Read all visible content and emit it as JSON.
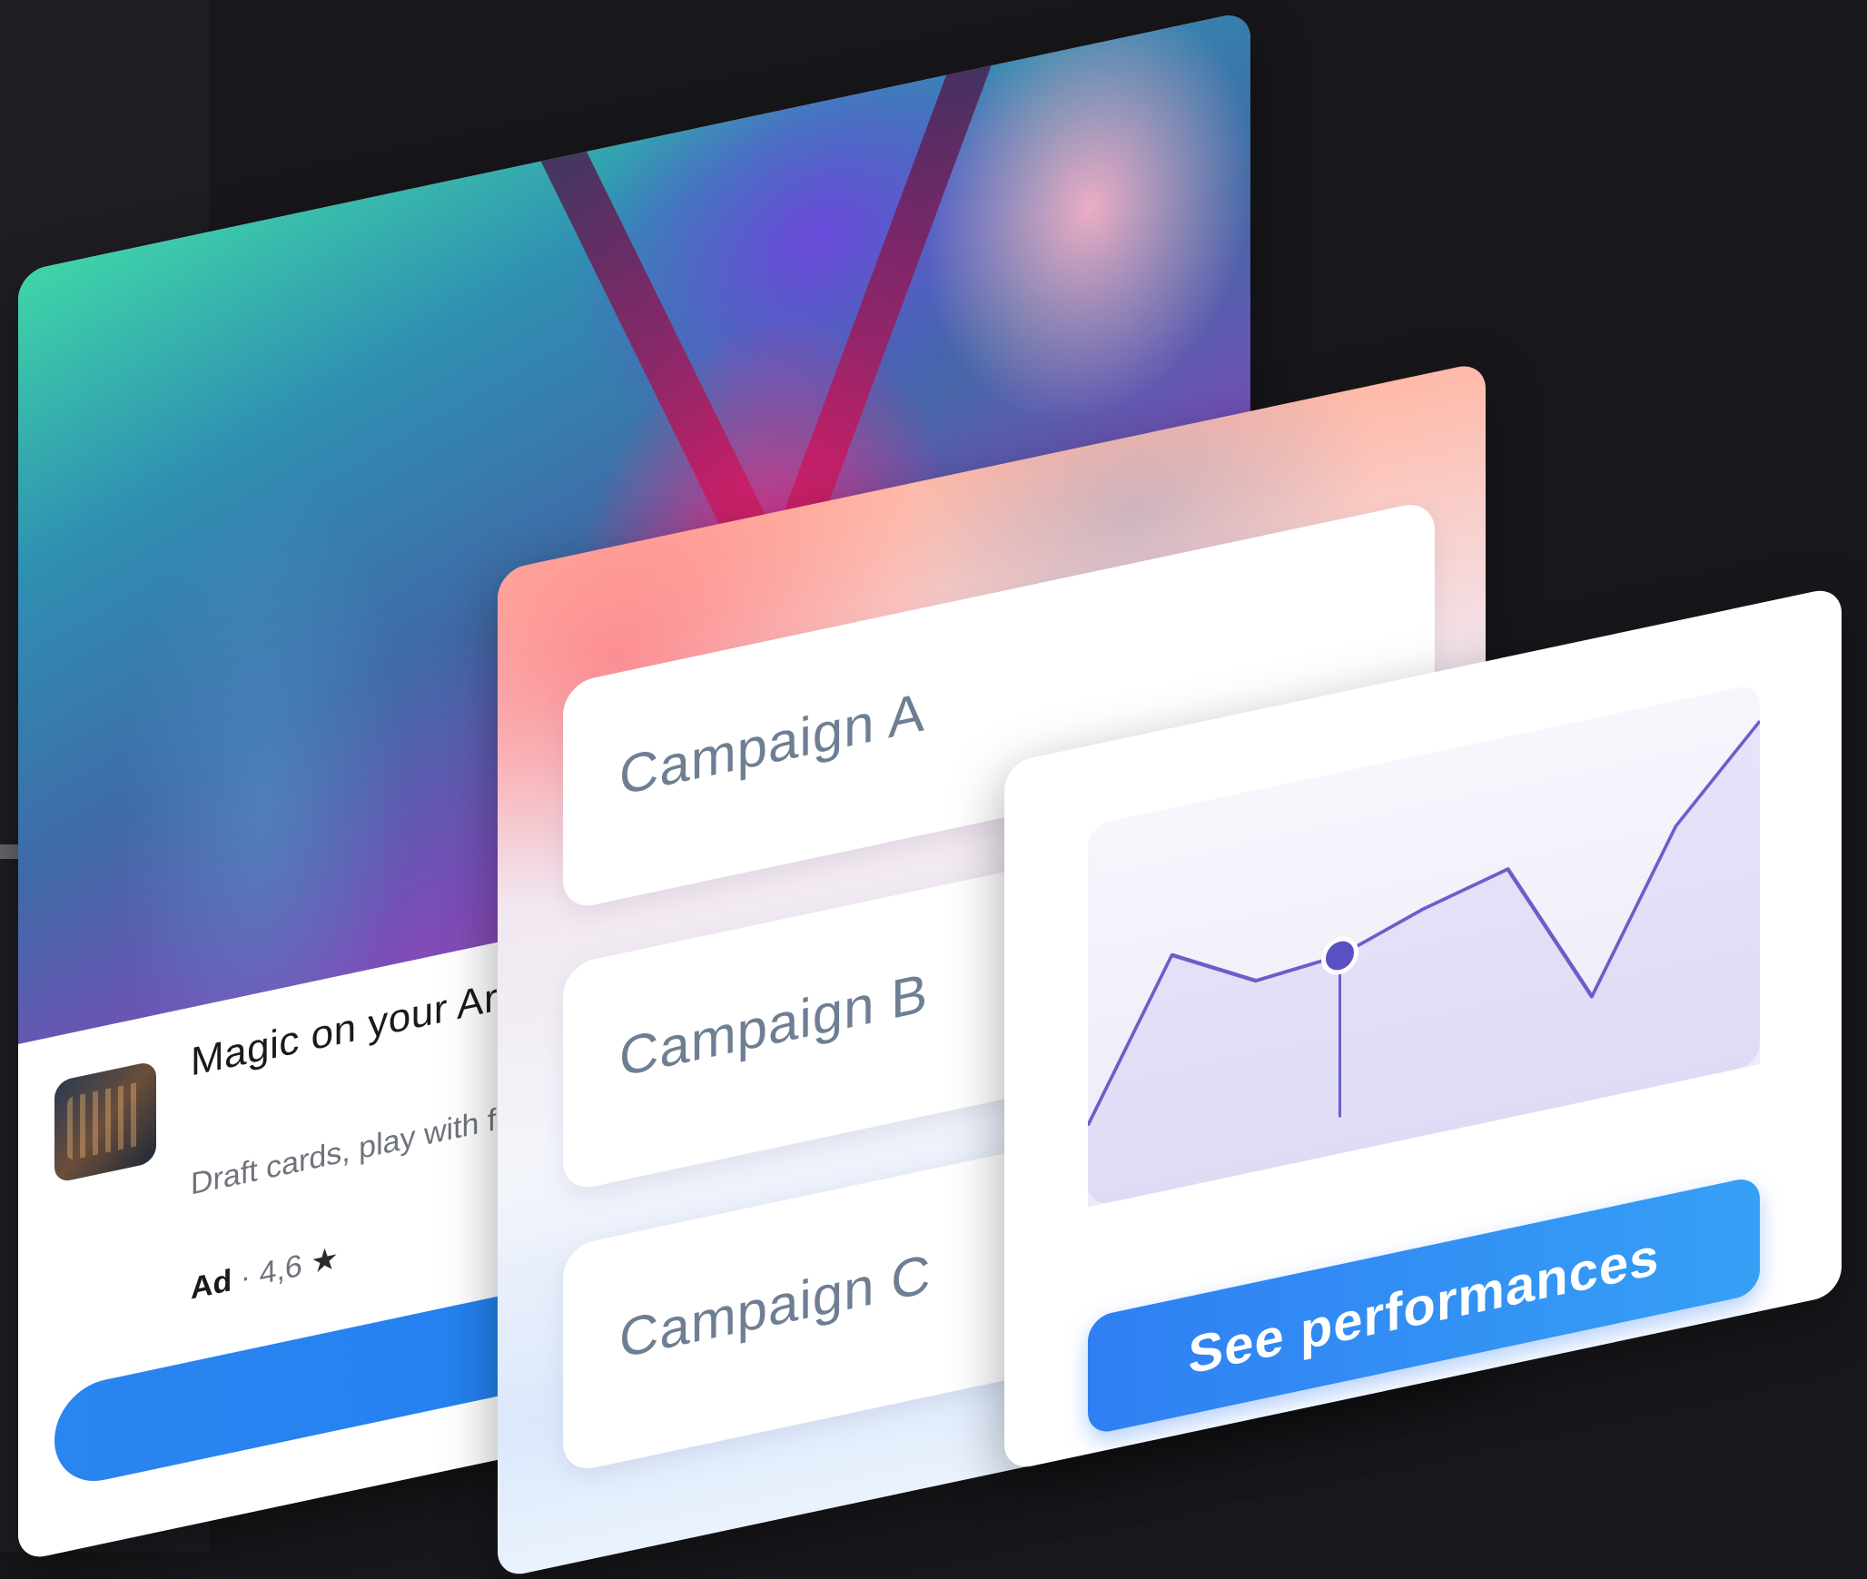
{
  "ad": {
    "title": "Magic on your Arena",
    "description": "Draft cards, play with friends. All on your",
    "label": "Ad",
    "rating": "4,6"
  },
  "campaigns": {
    "items": [
      {
        "label": "Campaign A"
      },
      {
        "label": "Campaign B"
      },
      {
        "label": "Campaign C"
      }
    ]
  },
  "performance": {
    "button_label": "See performances",
    "accent": "#2f7ff2",
    "line_color": "#6a5fc9"
  },
  "chart_data": {
    "type": "line",
    "title": "",
    "xlabel": "",
    "ylabel": "",
    "series": [
      {
        "values": [
          20,
          62,
          50,
          52,
          60,
          66,
          26,
          68,
          92
        ]
      }
    ],
    "highlight_index": 3,
    "ylim": [
      0,
      100
    ],
    "grid": false
  }
}
